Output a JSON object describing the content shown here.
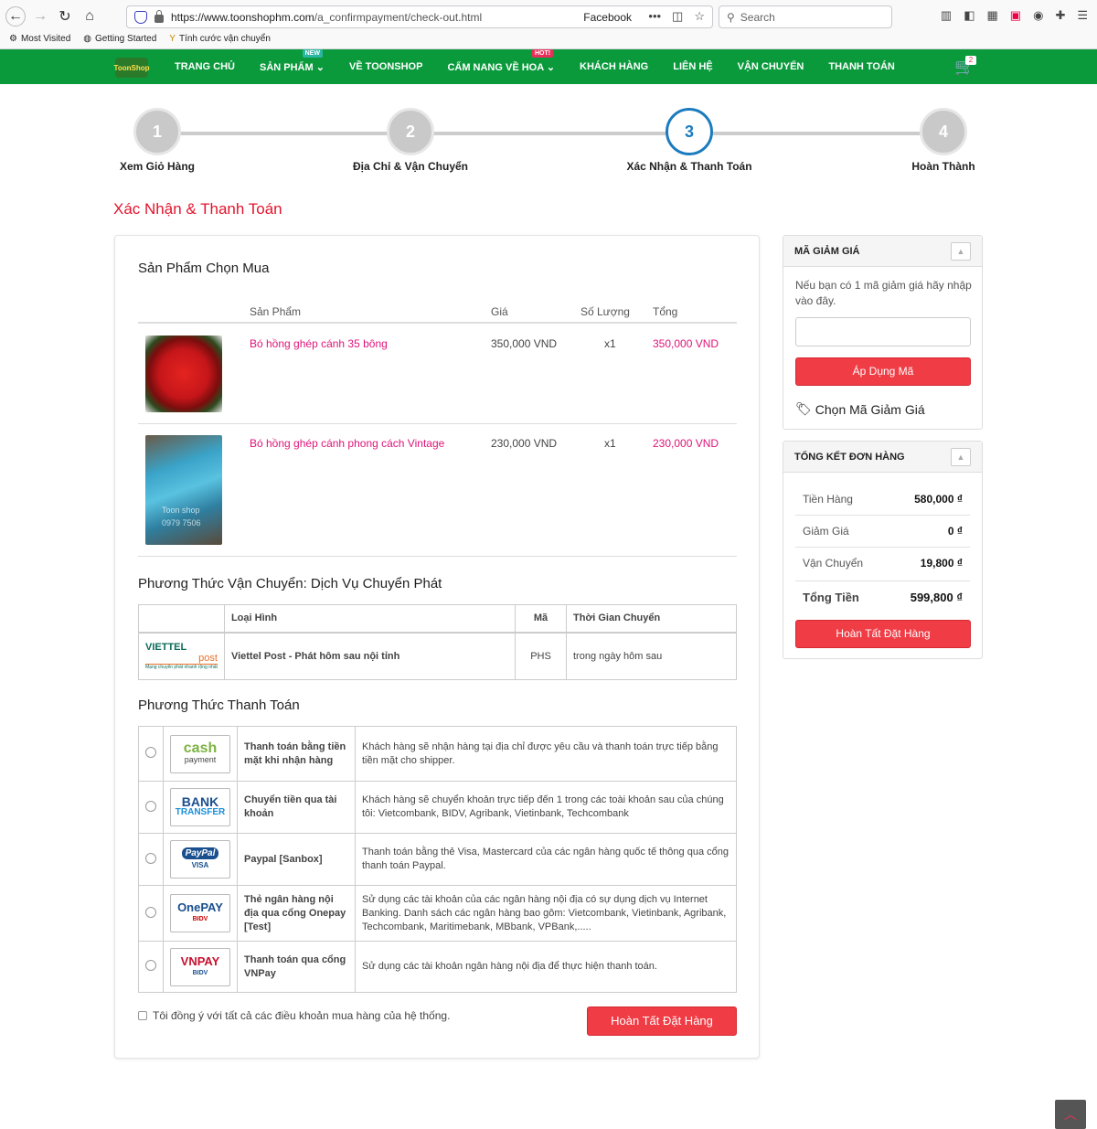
{
  "browser": {
    "url_domain": "https://www.toonshophm.com",
    "url_path": "/a_confirmpayment/check-out.html",
    "reader_label": "Facebook",
    "search_placeholder": "Search",
    "bookmarks": [
      "Most Visited",
      "Getting Started",
      "Tính cước vận chuyển"
    ]
  },
  "nav": {
    "logo_text": "ToonShop",
    "items": [
      {
        "label": "TRANG CHỦ"
      },
      {
        "label": "SẢN PHẨM",
        "badge": "NEW"
      },
      {
        "label": "VỀ TOONSHOP"
      },
      {
        "label": "CẨM NANG VỀ HOA",
        "badge": "HOT!"
      },
      {
        "label": "KHÁCH HÀNG"
      },
      {
        "label": "LIÊN HỆ"
      },
      {
        "label": "VẬN CHUYỂN"
      },
      {
        "label": "THANH TOÁN"
      }
    ],
    "cart_count": "2"
  },
  "steps": [
    {
      "num": "1",
      "label": "Xem Giỏ Hàng"
    },
    {
      "num": "2",
      "label": "Địa Chỉ & Vận Chuyển"
    },
    {
      "num": "3",
      "label": "Xác Nhận & Thanh Toán"
    },
    {
      "num": "4",
      "label": "Hoàn Thành"
    }
  ],
  "page_title": "Xác Nhận & Thanh Toán",
  "products": {
    "title": "Sản Phẩm Chọn Mua",
    "headers": {
      "product": "Sản Phẩm",
      "price": "Giá",
      "qty": "Số Lượng",
      "total": "Tổng"
    },
    "rows": [
      {
        "name": "Bó hồng ghép cánh 35 bông",
        "price": "350,000 VND",
        "qty": "x1",
        "total": "350,000 VND"
      },
      {
        "name": "Bó hồng ghép cánh phong cách Vintage",
        "price": "230,000 VND",
        "qty": "x1",
        "total": "230,000 VND",
        "img_caption": "Toon shop 0979 7506"
      }
    ]
  },
  "shipping": {
    "title": "Phương Thức Vận Chuyển: Dịch Vụ Chuyển Phát",
    "headers": {
      "type": "Loại Hình",
      "code": "Mã",
      "time": "Thời Gian Chuyển"
    },
    "logo_top": "VIETTEL",
    "logo_bottom": "post",
    "logo_tagline": "Mạng chuyển phát nhanh rộng nhất",
    "type": "Viettel Post - Phát hôm sau nội tỉnh",
    "code": "PHS",
    "time": "trong ngày hôm sau"
  },
  "payment": {
    "title": "Phương Thức Thanh Toán",
    "methods": [
      {
        "logo": "cash",
        "logo_sub": "payment",
        "name": "Thanh toán bằng tiền mặt khi nhận hàng",
        "desc": "Khách hàng sẽ nhận hàng tại địa chỉ được yêu cầu và thanh toán trực tiếp bằng tiền mặt cho shipper."
      },
      {
        "logo": "BANK",
        "logo_sub": "TRANSFER",
        "name": "Chuyển tiền qua tài khoản",
        "desc": "Khách hàng sẽ chuyển khoản trực tiếp đến 1 trong các toài khoản sau của chúng tôi: Vietcombank, BIDV, Agribank, Vietinbank, Techcombank"
      },
      {
        "logo": "PayPal",
        "logo_sub": "VISA",
        "name": "Paypal [Sanbox]",
        "desc": "Thanh toán bằng thẻ Visa, Mastercard của các ngân hàng quốc tế thông qua cổng thanh toán Paypal."
      },
      {
        "logo": "OnePAY",
        "logo_sub": "BIDV",
        "name": "Thẻ ngân hàng nội địa qua cổng Onepay [Test]",
        "desc": "Sử dụng các tài khoản của các ngân hàng nội địa có sự dụng dịch vụ Internet Banking. Danh sách các ngân hàng bao gôm: Vietcombank, Vietinbank, Agribank, Techcombank, Maritimebank, MBbank, VPBank,....."
      },
      {
        "logo": "VNPAY",
        "logo_sub": "BIDV",
        "name": "Thanh toán qua cổng VNPay",
        "desc": "Sử dụng các tài khoản ngân hàng nội địa để thực hiện thanh toán."
      }
    ],
    "agree_label": "Tôi đồng ý với tất cả các điều khoản mua hàng của hệ thống.",
    "submit_label": "Hoàn Tất Đặt Hàng"
  },
  "coupon": {
    "title": "MÃ GIẢM GIÁ",
    "hint": "Nếu bạn có 1 mã giảm giá hãy nhập vào đây.",
    "input_value": "",
    "apply_label": "Áp Dụng Mã",
    "choose_label": "Chọn Mã Giảm Giá"
  },
  "summary": {
    "title": "TỔNG KẾT ĐƠN HÀNG",
    "rows": [
      {
        "label": "Tiền Hàng",
        "value": "580,000 ₫"
      },
      {
        "label": "Giảm Giá",
        "value": "0 ₫"
      },
      {
        "label": "Vận Chuyển",
        "value": "19,800 ₫"
      }
    ],
    "total_label": "Tổng Tiền",
    "total_value": "599,800 ₫",
    "submit_label": "Hoàn Tất Đặt Hàng"
  },
  "colors": {
    "nav_green": "#0a9a3c",
    "accent_red": "#ef3c45",
    "title_red": "#e3142c",
    "product_pink": "#e0147a",
    "step_active_blue": "#1a7bbf"
  }
}
